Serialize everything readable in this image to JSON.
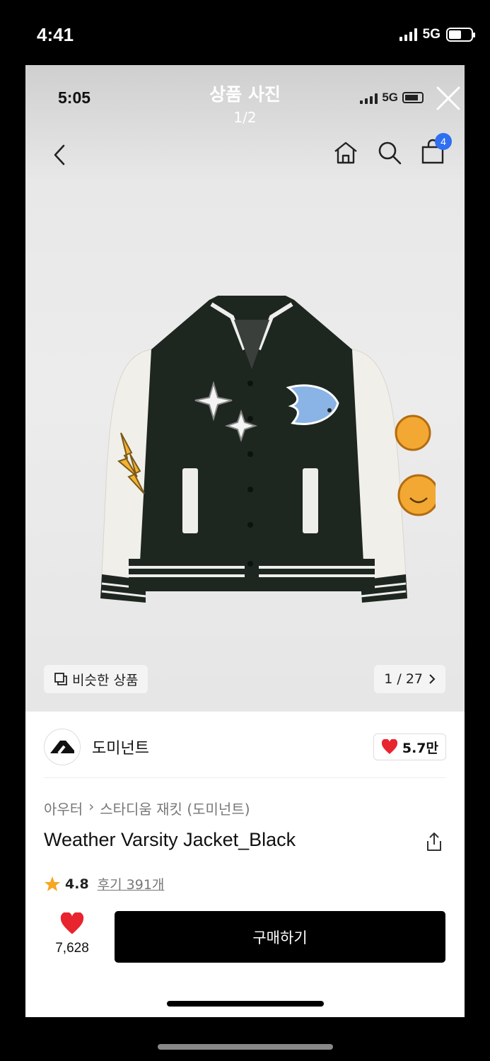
{
  "outer_status": {
    "time": "4:41",
    "network": "5G"
  },
  "inner_status": {
    "time": "5:05",
    "network": "5G"
  },
  "viewer": {
    "title": "상품 사진",
    "page": "1/2"
  },
  "nav": {
    "cart_badge": "4"
  },
  "photo_overlay": {
    "similar_label": "비슷한 상품",
    "counter": "1 / 27"
  },
  "brand": {
    "name": "도미넌트",
    "likes": "5.7만"
  },
  "product": {
    "breadcrumb": [
      "아우터",
      "스타디움 재킷 (도미넌트)"
    ],
    "title": "Weather Varsity Jacket_Black",
    "rating": "4.8",
    "reviews": "후기 391개"
  },
  "footer": {
    "wish_count": "7,628",
    "buy_label": "구매하기"
  },
  "colors": {
    "accent_red": "#e8242e",
    "badge_blue": "#2f6ff1",
    "buy_bg": "#000000"
  },
  "icons": [
    "back-icon",
    "home-icon",
    "search-icon",
    "cart-icon",
    "close-icon",
    "similar-icon",
    "chevron-right-icon",
    "heart-icon",
    "share-icon",
    "star-icon"
  ]
}
